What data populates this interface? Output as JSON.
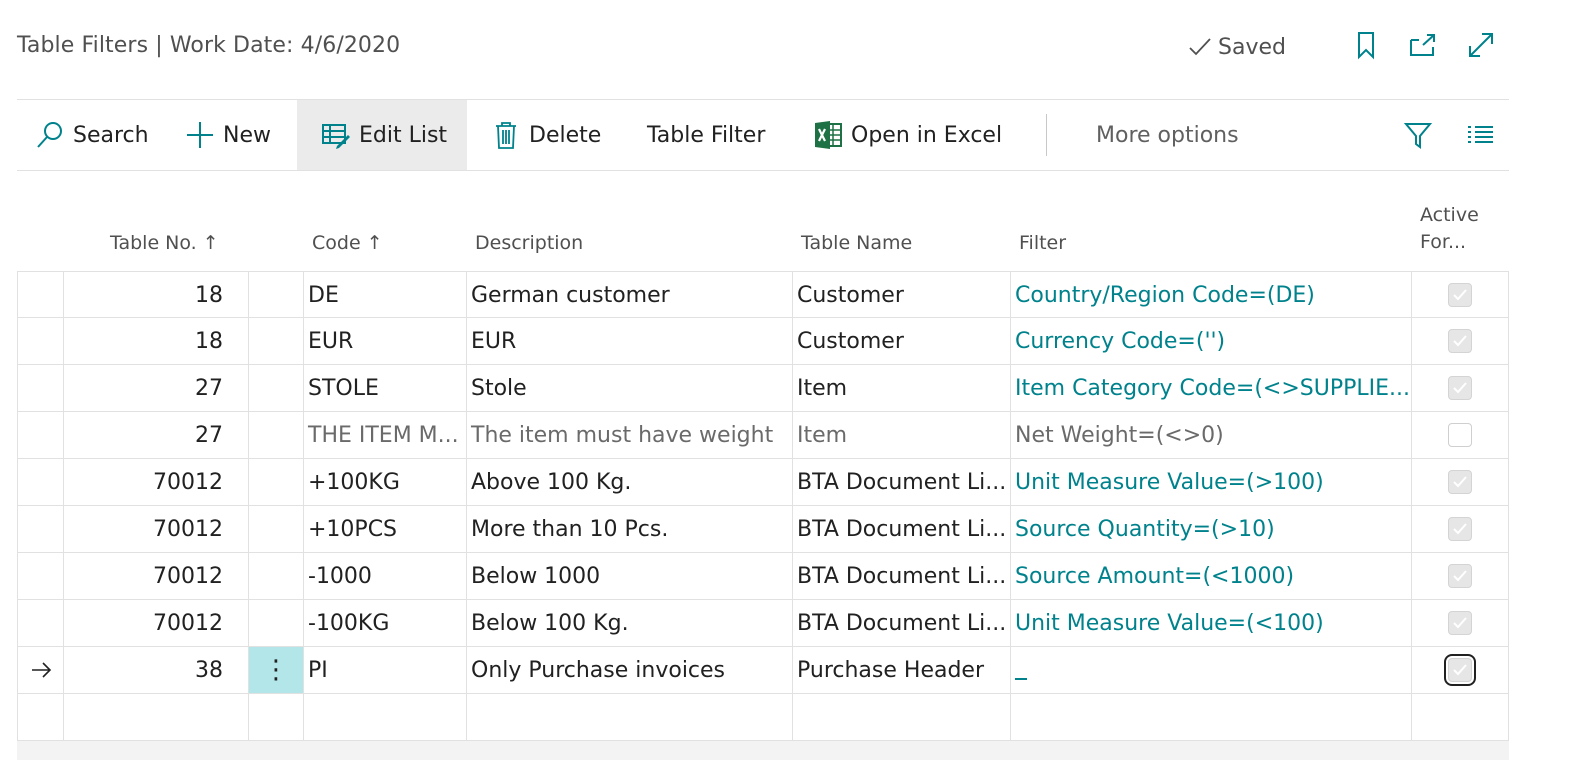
{
  "header": {
    "title": "Table Filters | Work Date: 4/6/2020",
    "saved_label": "Saved"
  },
  "icons": {
    "bookmark": "bookmark-icon",
    "open_new_window": "open-in-new-window-icon",
    "expand": "expand-icon"
  },
  "actions": {
    "search": "Search",
    "new": "New",
    "edit_list": "Edit List",
    "delete": "Delete",
    "table_filter": "Table Filter",
    "open_in_excel": "Open in Excel",
    "more_options": "More options"
  },
  "columns": {
    "table_no": "Table No.",
    "code": "Code",
    "description": "Description",
    "table_name": "Table Name",
    "filter": "Filter",
    "active_line1": "Active",
    "active_line2": "For..."
  },
  "rows": [
    {
      "table_no": "18",
      "code": "DE",
      "description": "German customer",
      "table_name": "Customer",
      "filter": "Country/Region Code=(DE)",
      "active": true
    },
    {
      "table_no": "18",
      "code": "EUR",
      "description": "EUR",
      "table_name": "Customer",
      "filter": "Currency Code=('')",
      "active": true
    },
    {
      "table_no": "27",
      "code": "STOLE",
      "description": "Stole",
      "table_name": "Item",
      "filter": "Item Category Code=(<>SUPPLIE...",
      "active": true
    },
    {
      "table_no": "27",
      "code": "THE ITEM M...",
      "description": "The item must have weight",
      "table_name": "Item",
      "filter": "Net Weight=(<>0)",
      "active": false
    },
    {
      "table_no": "70012",
      "code": "+100KG",
      "description": "Above 100 Kg.",
      "table_name": "BTA Document Li...",
      "filter": "Unit Measure Value=(>100)",
      "active": true
    },
    {
      "table_no": "70012",
      "code": "+10PCS",
      "description": "More than 10 Pcs.",
      "table_name": "BTA Document Li...",
      "filter": "Source Quantity=(>10)",
      "active": true
    },
    {
      "table_no": "70012",
      "code": "-1000",
      "description": "Below 1000",
      "table_name": "BTA Document Li...",
      "filter": "Source Amount=(<1000)",
      "active": true
    },
    {
      "table_no": "70012",
      "code": "-100KG",
      "description": "Below 100 Kg.",
      "table_name": "BTA Document Li...",
      "filter": "Unit Measure Value=(<100)",
      "active": true
    },
    {
      "table_no": "38",
      "code": "PI",
      "description": "Only Purchase invoices",
      "table_name": "Purchase Header",
      "filter": "",
      "active": true
    }
  ],
  "colors": {
    "filter_link": "#00828c",
    "selected_menu_cell": "#b3e6e9",
    "excel_green": "#1e7145"
  }
}
